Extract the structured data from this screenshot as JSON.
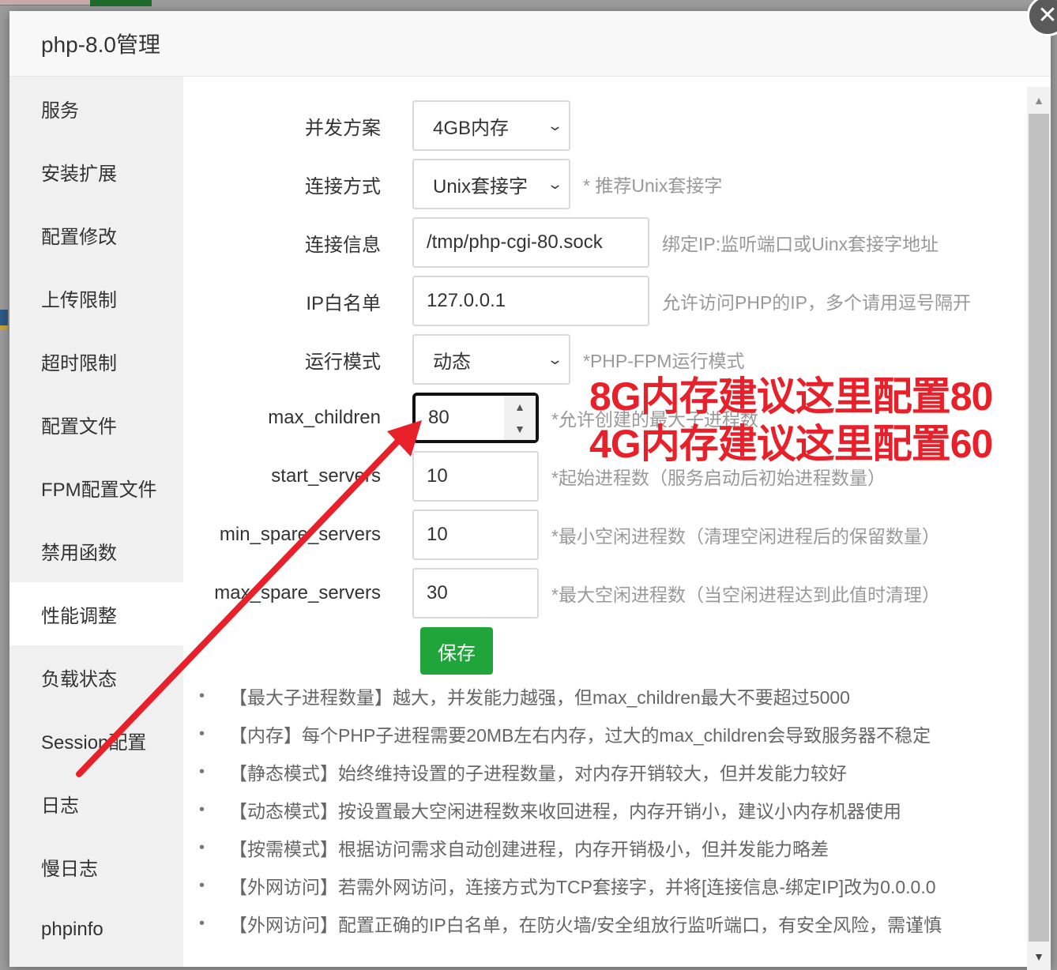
{
  "background": {
    "right_fragment": "·"
  },
  "modal": {
    "title": "php-8.0管理",
    "close_icon": "close-icon"
  },
  "sidebar": {
    "items": [
      {
        "label": "服务",
        "active": false
      },
      {
        "label": "安装扩展",
        "active": false
      },
      {
        "label": "配置修改",
        "active": false
      },
      {
        "label": "上传限制",
        "active": false
      },
      {
        "label": "超时限制",
        "active": false
      },
      {
        "label": "配置文件",
        "active": false
      },
      {
        "label": "FPM配置文件",
        "active": false
      },
      {
        "label": "禁用函数",
        "active": false
      },
      {
        "label": "性能调整",
        "active": true
      },
      {
        "label": "负载状态",
        "active": false
      },
      {
        "label": "Session配置",
        "active": false
      },
      {
        "label": "日志",
        "active": false
      },
      {
        "label": "慢日志",
        "active": false
      },
      {
        "label": "phpinfo",
        "active": false
      }
    ]
  },
  "form": {
    "concurrency_plan": {
      "label": "并发方案",
      "value": "4GB内存"
    },
    "connection_mode": {
      "label": "连接方式",
      "value": "Unix套接字",
      "hint": "* 推荐Unix套接字"
    },
    "connection_info": {
      "label": "连接信息",
      "value": "/tmp/php-cgi-80.sock",
      "hint": "绑定IP:监听端口或Uinx套接字地址"
    },
    "ip_whitelist": {
      "label": "IP白名单",
      "value": "127.0.0.1",
      "hint": "允许访问PHP的IP，多个请用逗号隔开"
    },
    "run_mode": {
      "label": "运行模式",
      "value": "动态",
      "hint": "*PHP-FPM运行模式"
    },
    "max_children": {
      "label": "max_children",
      "value": "80",
      "hint": "*允许创建的最大子进程数"
    },
    "start_servers": {
      "label": "start_servers",
      "value": "10",
      "hint": "*起始进程数（服务启动后初始进程数量）"
    },
    "min_spare_servers": {
      "label": "min_spare_servers",
      "value": "10",
      "hint": "*最小空闲进程数（清理空闲进程后的保留数量）"
    },
    "max_spare_servers": {
      "label": "max_spare_servers",
      "value": "30",
      "hint": "*最大空闲进程数（当空闲进程达到此值时清理）"
    },
    "save_label": "保存"
  },
  "notes": [
    "【最大子进程数量】越大，并发能力越强，但max_children最大不要超过5000",
    "【内存】每个PHP子进程需要20MB左右内存，过大的max_children会导致服务器不稳定",
    "【静态模式】始终维持设置的子进程数量，对内存开销较大，但并发能力较好",
    "【动态模式】按设置最大空闲进程数来收回进程，内存开销小，建议小内存机器使用",
    "【按需模式】根据访问需求自动创建进程，内存开销极小，但并发能力略差",
    "【外网访问】若需外网访问，连接方式为TCP套接字，并将[连接信息-绑定IP]改为0.0.0.0",
    "【外网访问】配置正确的IP白名单，在防火墙/安全组放行监听端口，有安全风险，需谨慎"
  ],
  "annotation": {
    "line1": "8G内存建议这里配置80",
    "line2": "4G内存建议这里配置60",
    "color": "#e8202a"
  },
  "colors": {
    "save_button": "#20a53a",
    "annotation_red": "#e8202a"
  },
  "icons": {
    "chevron": "⌄",
    "spin_up": "▲",
    "spin_down": "▼",
    "scroll_up": "▲",
    "scroll_down": "▼",
    "bullet": "•",
    "close": "✕"
  }
}
